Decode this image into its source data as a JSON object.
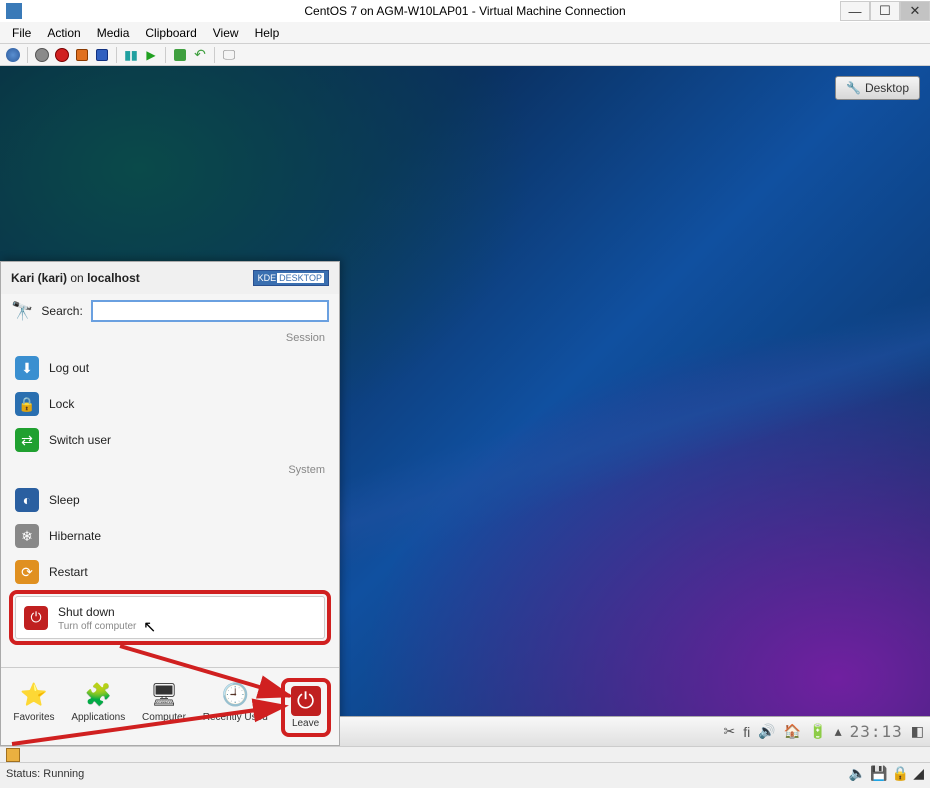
{
  "titlebar": {
    "title": "CentOS 7 on AGM-W10LAP01 - Virtual Machine Connection"
  },
  "menubar": {
    "items": [
      "File",
      "Action",
      "Media",
      "Clipboard",
      "View",
      "Help"
    ]
  },
  "desktop_badge": "Desktop",
  "kickoff": {
    "user_name": "Kari (kari)",
    "user_on": "on",
    "user_host": "localhost",
    "kde_badge_left": "KDE",
    "kde_badge_right": "DESKTOP",
    "search_label": "Search:",
    "search_value": "",
    "section_session": "Session",
    "section_system": "System",
    "session_items": [
      {
        "label": "Log out"
      },
      {
        "label": "Lock"
      },
      {
        "label": "Switch user"
      }
    ],
    "system_items": [
      {
        "label": "Sleep"
      },
      {
        "label": "Hibernate"
      },
      {
        "label": "Restart"
      },
      {
        "label": "Shut down",
        "sub": "Turn off computer"
      }
    ],
    "tabs": [
      {
        "label": "Favorites"
      },
      {
        "label": "Applications"
      },
      {
        "label": "Computer"
      },
      {
        "label": "Recently Used"
      },
      {
        "label": "Leave"
      }
    ]
  },
  "kde_tray": {
    "keyboard": "fi",
    "clock": "23:13"
  },
  "statusbar": {
    "text": "Status: Running"
  }
}
